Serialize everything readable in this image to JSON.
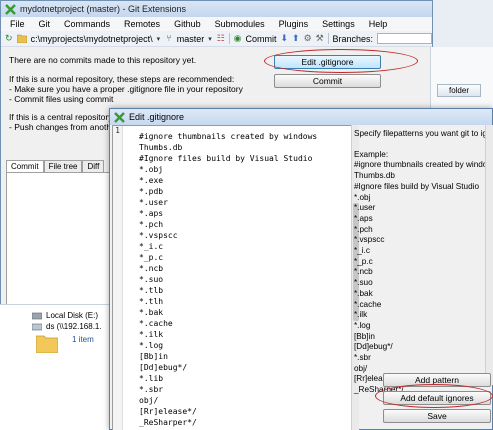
{
  "main_window": {
    "title": "mydotnetproject (master) - Git Extensions",
    "menu": [
      "File",
      "Git",
      "Commands",
      "Remotes",
      "Github",
      "Submodules",
      "Plugins",
      "Settings",
      "Help"
    ],
    "toolbar": {
      "path": "c:\\myprojects\\mydotnetproject\\",
      "branch": "master",
      "commit_label": "Commit",
      "branches_label": "Branches:"
    },
    "messages": {
      "no_commits": "There are no commits made to this repository yet.",
      "normal_repo": "If this is a normal repository, these steps are recommended:",
      "step1": "- Make sure you have a proper .gitignore file in your repository",
      "step2": "- Commit files using commit",
      "central_repo": "If this is a central repository, set",
      "step3": "- Push changes from another"
    },
    "buttons": {
      "edit_gitignore": "Edit .gitignore",
      "commit": "Commit"
    },
    "tabs": [
      "Commit",
      "File tree",
      "Diff"
    ],
    "right_strip": {
      "folder_label": "folder"
    }
  },
  "explorer": {
    "local_disk": "Local Disk (E:)",
    "network": "ds (\\\\192.168.1.",
    "items_count": "1 item"
  },
  "dialog": {
    "title": "Edit .gitignore",
    "line_numbers": [
      "1",
      "2",
      "3",
      "4",
      "5",
      "6",
      "7",
      "8",
      "9",
      "10",
      "11",
      "12",
      "13",
      "14",
      "15",
      "16",
      "17",
      "18",
      "19",
      "20",
      "21",
      "22",
      "23",
      "24",
      "25",
      "26",
      "27",
      "28",
      "29"
    ],
    "lines": [
      "#ignore thumbnails created by windows",
      "Thumbs.db",
      "#Ignore files build by Visual Studio",
      "*.obj",
      "*.exe",
      "*.pdb",
      "*.user",
      "*.aps",
      "*.pch",
      "*.vspscc",
      "*_i.c",
      "*_p.c",
      "*.ncb",
      "*.suo",
      "*.tlb",
      "*.tlh",
      "*.bak",
      "*.cache",
      "*.ilk",
      "*.log",
      "[Bb]in",
      "[Dd]ebug*/",
      "*.lib",
      "*.sbr",
      "obj/",
      "[Rr]elease*/",
      "_ReSharper*/",
      "[Tt]est[Rr]esult*"
    ],
    "help_lines": [
      "Specify filepatterns you want git to ignore.",
      "",
      "Example:",
      "#ignore thumbnails created by windows",
      "Thumbs.db",
      "#Ignore files build by Visual Studio",
      "*.obj",
      "*.user",
      "*.aps",
      "*.pch",
      "*.vspscc",
      "*_i.c",
      "*_p.c",
      "*.ncb",
      "*.suo",
      "*.bak",
      "*.cache",
      "*.ilk",
      "*.log",
      "[Bb]in",
      "[Dd]ebug*/",
      "*.sbr",
      "obj/",
      "[Rr]elease*/",
      "_ReSharper*/"
    ],
    "buttons": {
      "add_pattern": "Add pattern",
      "add_default_ignores": "Add default ignores",
      "save": "Save"
    }
  },
  "colors": {
    "highlight_ellipse": "#c0282a",
    "titlebar": "#c6d8ef"
  }
}
